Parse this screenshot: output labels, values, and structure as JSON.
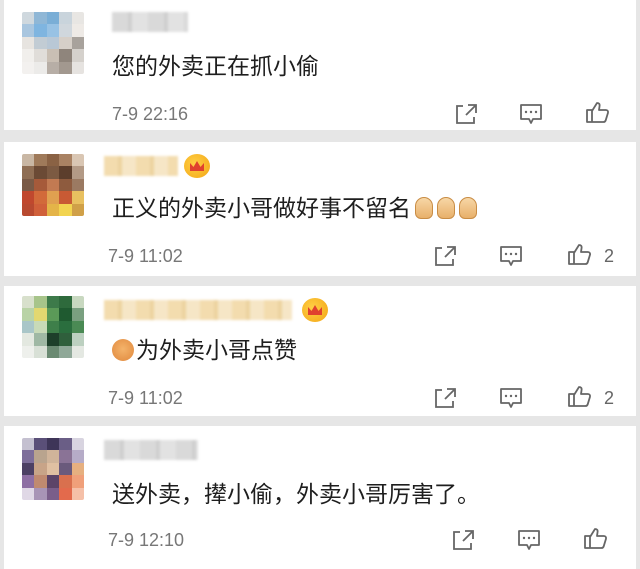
{
  "comments": [
    {
      "text": "您的外卖正在抓小偷",
      "time": "7-9 22:16",
      "likes": "",
      "vip": false
    },
    {
      "text": "正义的外卖小哥做好事不留名",
      "time": "7-9 11:02",
      "likes": "2",
      "vip": true
    },
    {
      "text": "为外卖小哥点赞",
      "time": "7-9 11:02",
      "likes": "2",
      "vip": true
    },
    {
      "text": "送外卖，撵小偷，外卖小哥厉害了。",
      "time": "7-9 12:10",
      "likes": "",
      "vip": false
    }
  ],
  "icons": {
    "share": "share-icon",
    "reply": "comment-icon",
    "like": "thumbs-up-icon"
  },
  "colors": {
    "background": "#e6e6e6",
    "card": "#ffffff",
    "meta_text": "#777777",
    "vip_gold": "#f3a514"
  }
}
